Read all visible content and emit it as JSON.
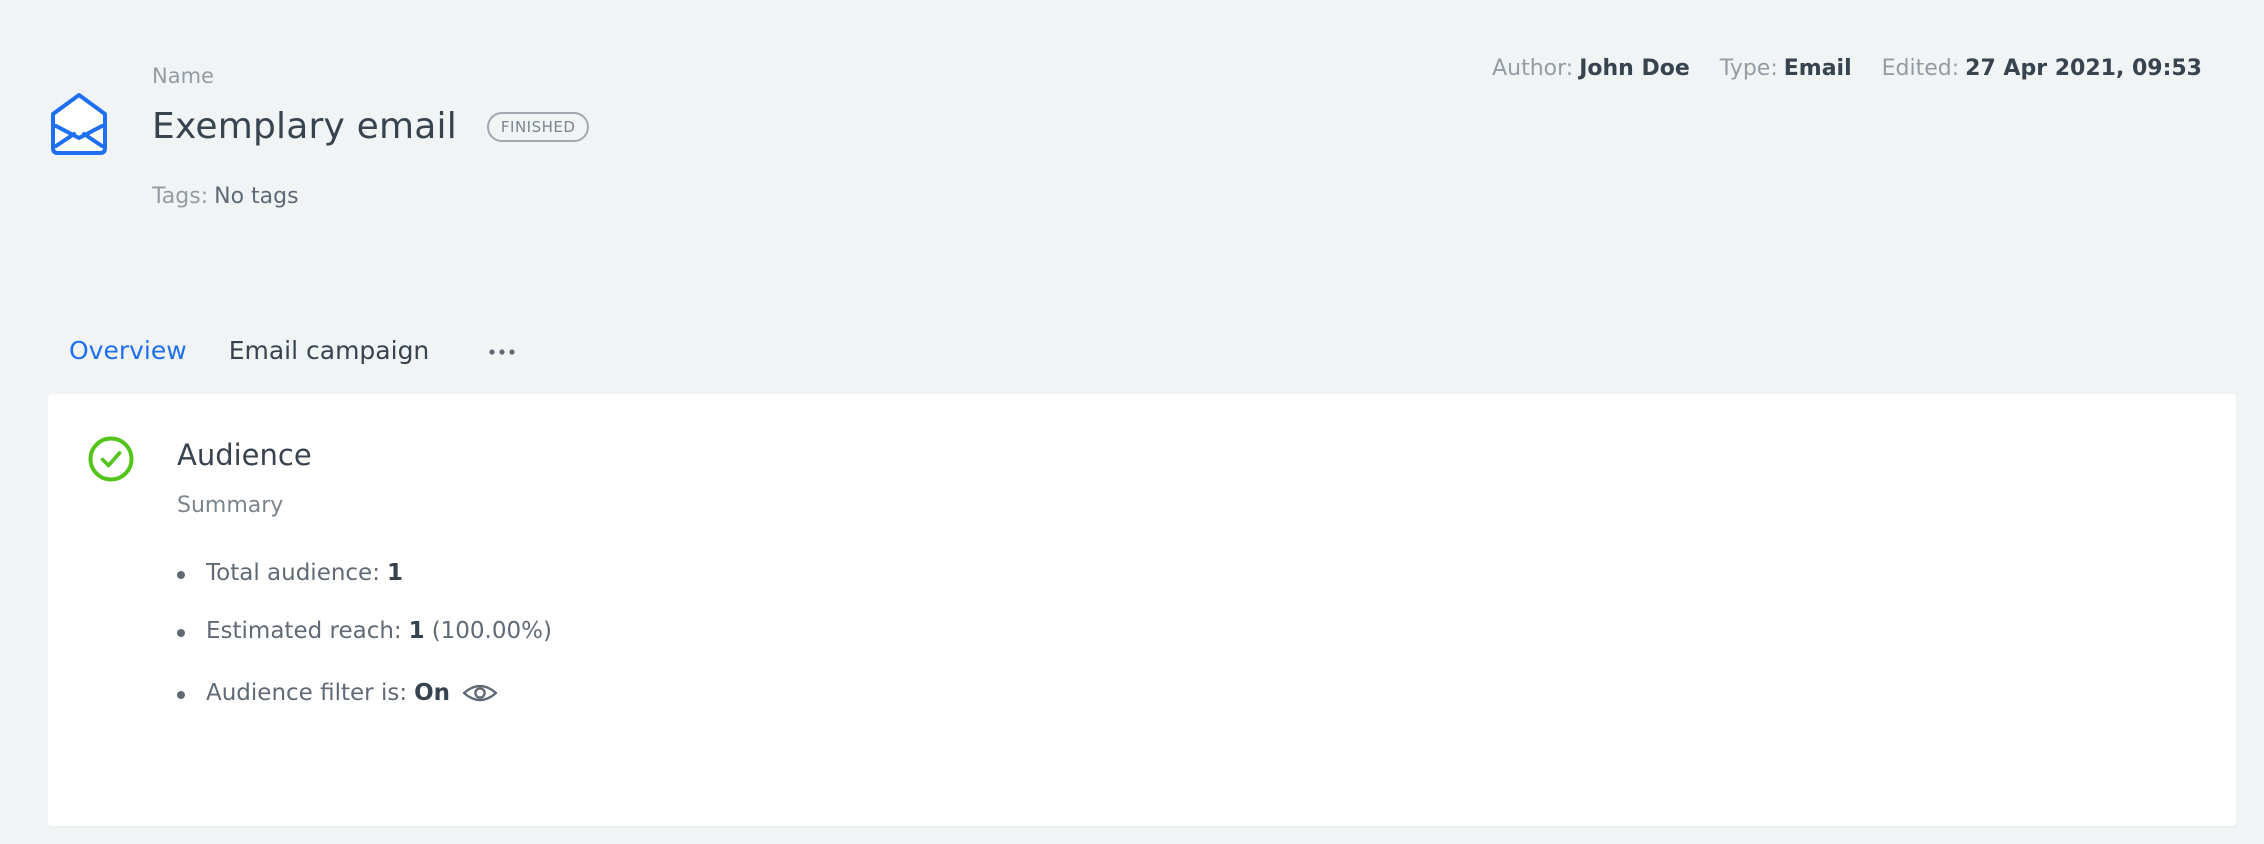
{
  "header": {
    "name_label": "Name",
    "title": "Exemplary email",
    "status": "FINISHED",
    "tags_label": "Tags:",
    "tags_value": "No tags",
    "icon": "envelope-open-icon"
  },
  "meta": {
    "author_label": "Author:",
    "author": "John Doe",
    "type_label": "Type:",
    "type": "Email",
    "edited_label": "Edited:",
    "edited": "27 Apr 2021, 09:53"
  },
  "tabs": [
    {
      "label": "Overview",
      "active": true
    },
    {
      "label": "Email campaign",
      "active": false
    }
  ],
  "more_icon": "more-horizontal-icon",
  "audience": {
    "title": "Audience",
    "subtitle": "Summary",
    "status_icon": "check-circle-icon",
    "total_label": "Total audience:",
    "total_value": "1",
    "reach_label": "Estimated reach:",
    "reach_value": "1",
    "reach_pct": "(100.00%)",
    "filter_label": "Audience filter is:",
    "filter_value": "On",
    "filter_icon": "eye-icon"
  },
  "colors": {
    "background": "#f0f4f5",
    "accent": "#1e6ff2",
    "success": "#52c41a",
    "text": "#384350",
    "muted": "#949ba3"
  }
}
